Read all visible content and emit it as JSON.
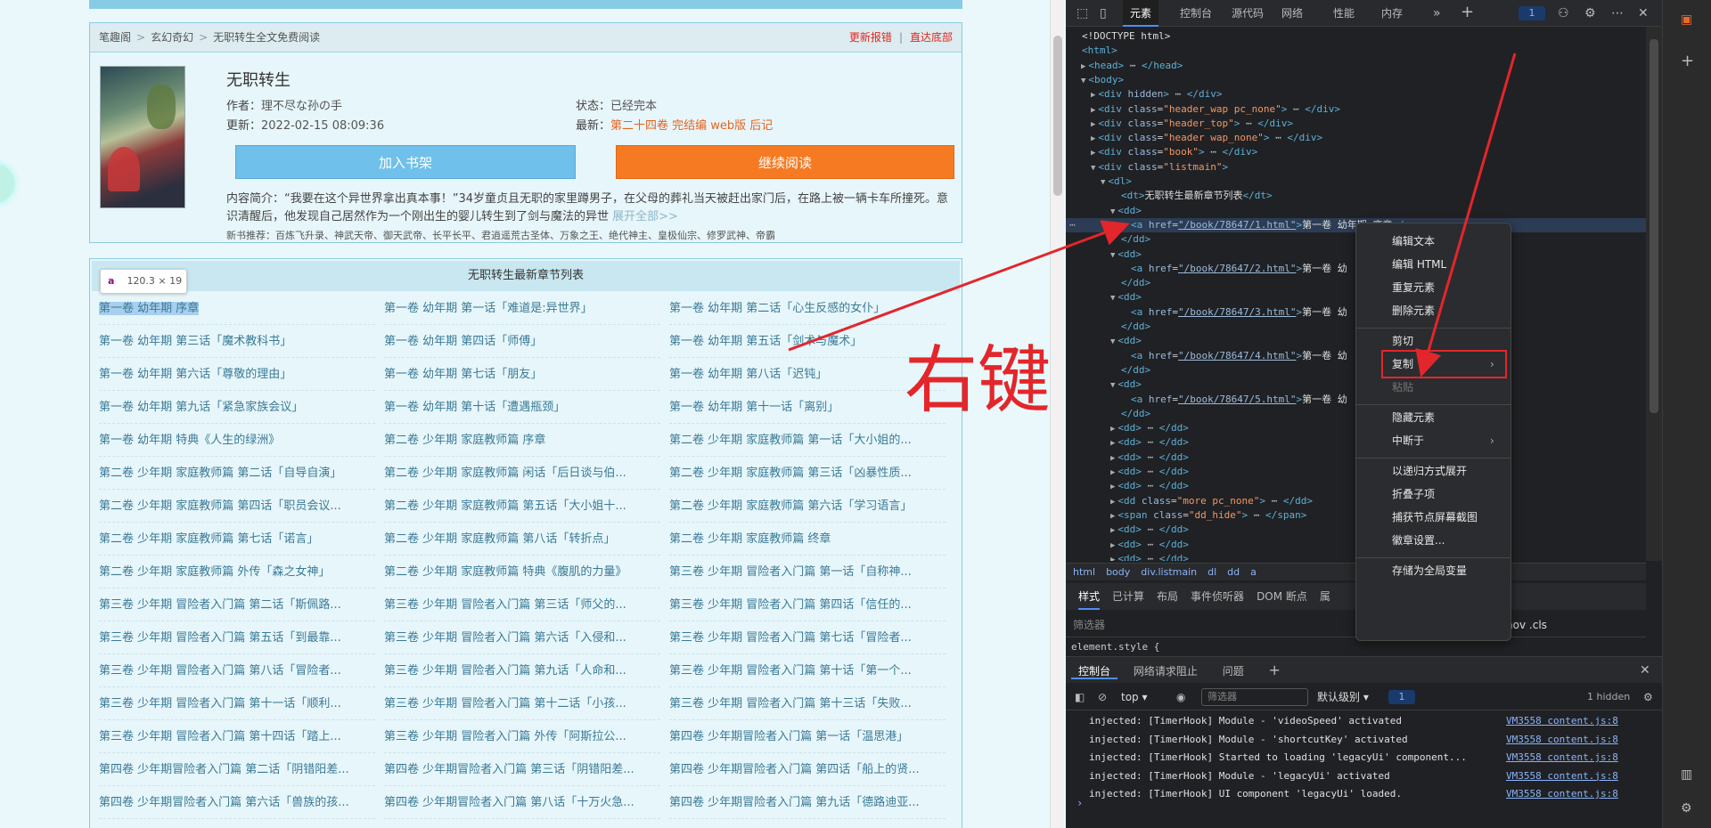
{
  "breadcrumb": {
    "items": [
      "笔趣阁",
      "玄幻奇幻",
      "无职转生全文免费阅读"
    ],
    "sep": ">",
    "right_links": [
      "更新报错",
      "直达底部"
    ]
  },
  "book": {
    "title": "无职转生",
    "author_label": "作者：",
    "author": "理不尽な孙の手",
    "status_label": "状态：",
    "status": "已经完本",
    "update_label": "更新：",
    "update": "2022-02-15 08:09:36",
    "latest_label": "最新：",
    "latest": "第二十四卷 完结编 web版 后记",
    "shelf_button": "加入书架",
    "read_button": "继续阅读",
    "intro": "内容简介：“我要在这个异世界拿出真本事！”34岁童贞且无职的家里蹲男子，在父母的葬礼当天被赶出家门后，在路上被一辆卡车所撞死。意识清醒后，他发现自己居然作为一个刚出生的婴儿转生到了剑与魔法的异世",
    "intro_more": "展开全部>>",
    "recommend": "新书推荐：百炼飞升录、神武天帝、御天武帝、长平长平、君逍遥荒古圣体、万象之王、绝代神主、皇极仙宗、修罗武神、帝霸"
  },
  "chapter_list": {
    "title": "无职转生最新章节列表",
    "chapters": [
      "第一卷 幼年期 序章",
      "第一卷 幼年期 第一话「难道是:异世界」",
      "第一卷 幼年期 第二话「心生反感的女仆」",
      "第一卷 幼年期 第三话「魔术教科书」",
      "第一卷 幼年期 第四话「师傅」",
      "第一卷 幼年期 第五话「剑术与魔术」",
      "第一卷 幼年期 第六话「尊敬的理由」",
      "第一卷 幼年期 第七话「朋友」",
      "第一卷 幼年期 第八话「迟钝」",
      "第一卷 幼年期 第九话「紧急家族会议」",
      "第一卷 幼年期 第十话「遭遇瓶颈」",
      "第一卷 幼年期 第十一话「离别」",
      "第一卷 幼年期 特典《人生的绿洲》",
      "第二卷 少年期 家庭教师篇 序章",
      "第二卷 少年期 家庭教师篇 第一话「大小姐的...",
      "第二卷 少年期 家庭教师篇 第二话「自导自演」",
      "第二卷 少年期 家庭教师篇 闲话「后日谈与伯...",
      "第二卷 少年期 家庭教师篇 第三话「凶暴性质...",
      "第二卷 少年期 家庭教师篇 第四话「职员会议...",
      "第二卷 少年期 家庭教师篇 第五话「大小姐十...",
      "第二卷 少年期 家庭教师篇 第六话「学习语言」",
      "第二卷 少年期 家庭教师篇 第七话「诺言」",
      "第二卷 少年期 家庭教师篇 第八话「转折点」",
      "第二卷 少年期 家庭教师篇 终章",
      "第二卷 少年期 家庭教师篇 外传「森之女神」",
      "第二卷 少年期 家庭教师篇 特典《腹肌的力量》",
      "第三卷 少年期 冒险者入门篇 第一话「自称神...",
      "第三卷 少年期 冒险者入门篇 第二话「斯佩路...",
      "第三卷 少年期 冒险者入门篇 第三话「师父的...",
      "第三卷 少年期 冒险者入门篇 第四话「信任的...",
      "第三卷 少年期 冒险者入门篇 第五话「到最靠...",
      "第三卷 少年期 冒险者入门篇 第六话「入侵和...",
      "第三卷 少年期 冒险者入门篇 第七话「冒险者...",
      "第三卷 少年期 冒险者入门篇 第八话「冒险者...",
      "第三卷 少年期 冒险者入门篇 第九话「人命和...",
      "第三卷 少年期 冒险者入门篇 第十话「第一个...",
      "第三卷 少年期 冒险者入门篇 第十一话「顺利...",
      "第三卷 少年期 冒险者入门篇 第十二话「小孩...",
      "第三卷 少年期 冒险者入门篇 第十三话「失败...",
      "第三卷 少年期 冒险者入门篇 第十四话「踏上...",
      "第三卷 少年期 冒险者入门篇 外传「阿斯拉公...",
      "第四卷 少年期冒险者入门篇 第一话「温思港」",
      "第四卷 少年期冒险者入门篇 第二话「阴错阳差...",
      "第四卷 少年期冒险者入门篇 第三话「阴错阳差...",
      "第四卷 少年期冒险者入门篇 第四话「船上的贤...",
      "第四卷 少年期冒险者入门篇 第六话「兽族的孩...",
      "第四卷 少年期冒险者入门篇 第八话「十万火急...",
      "第四卷 少年期冒险者入门篇 第九话「德路迪亚..."
    ]
  },
  "tooltip": {
    "tag": "a",
    "size": "120.3 × 19"
  },
  "annotation": {
    "text": "右键",
    "color": "#e3262b"
  },
  "devtools": {
    "tabs": [
      "元素",
      "控制台",
      "源代码",
      "网络",
      "性能",
      "内存"
    ],
    "issues_badge": "1",
    "dom_lines": [
      {
        "indent": 0,
        "html": "&lt;!DOCTYPE html&gt;",
        "kind": "txt"
      },
      {
        "indent": 0,
        "html": "<span class=tag>&lt;html&gt;</span>"
      },
      {
        "indent": 1,
        "html": "<span class=tag>&lt;head&gt;</span> ⋯ <span class=tag>&lt;/head&gt;</span>",
        "arrow": "▶"
      },
      {
        "indent": 1,
        "html": "<span class=tag>&lt;body&gt;</span>",
        "arrow": "▼"
      },
      {
        "indent": 2,
        "html": "<span class=tag>&lt;div</span> <span class=attr>hidden</span><span class=tag>&gt;</span> ⋯ <span class=tag>&lt;/div&gt;</span>",
        "arrow": "▶"
      },
      {
        "indent": 2,
        "html": "<span class=tag>&lt;div</span> <span class=attr>class</span>=<span class=val>\"header_wap pc_none\"</span><span class=tag>&gt;</span> ⋯ <span class=tag>&lt;/div&gt;</span>",
        "arrow": "▶"
      },
      {
        "indent": 2,
        "html": "<span class=tag>&lt;div</span> <span class=attr>class</span>=<span class=val>\"header_top\"</span><span class=tag>&gt;</span> ⋯ <span class=tag>&lt;/div&gt;</span>",
        "arrow": "▶"
      },
      {
        "indent": 2,
        "html": "<span class=tag>&lt;div</span> <span class=attr>class</span>=<span class=val>\"header wap_none\"</span><span class=tag>&gt;</span> ⋯ <span class=tag>&lt;/div&gt;</span>",
        "arrow": "▶"
      },
      {
        "indent": 2,
        "html": "<span class=tag>&lt;div</span> <span class=attr>class</span>=<span class=val>\"book\"</span><span class=tag>&gt;</span> ⋯ <span class=tag>&lt;/div&gt;</span>",
        "arrow": "▶"
      },
      {
        "indent": 2,
        "html": "<span class=tag>&lt;div</span> <span class=attr>class</span>=<span class=val>\"listmain\"</span><span class=tag>&gt;</span>",
        "arrow": "▼"
      },
      {
        "indent": 3,
        "html": "<span class=tag>&lt;dl&gt;</span>",
        "arrow": "▼"
      },
      {
        "indent": 4,
        "html": "<span class=tag>&lt;dt&gt;</span><span class=txt>无职转生最新章节列表</span><span class=tag>&lt;/dt&gt;</span>"
      },
      {
        "indent": 4,
        "html": "<span class=tag>&lt;dd&gt;</span>",
        "arrow": "▼"
      },
      {
        "indent": 5,
        "html": "<span class=tag>&lt;a</span> <span class=attr>href</span>=<span class=link>\"/book/78647/1.html\"</span><span class=tag>&gt;</span><span class=txt>第一卷 幼年期 序章</span><span class=tag>&lt;/a&gt;</span>",
        "hl": true
      },
      {
        "indent": 4,
        "html": "<span class=tag>&lt;/dd&gt;</span>"
      },
      {
        "indent": 4,
        "html": "<span class=tag>&lt;dd&gt;</span>",
        "arrow": "▼"
      },
      {
        "indent": 5,
        "html": "<span class=tag>&lt;a</span> <span class=attr>href</span>=<span class=link>\"/book/78647/2.html\"</span><span class=tag>&gt;</span><span class=txt>第一卷 幼</span>"
      },
      {
        "indent": 4,
        "html": "<span class=tag>&lt;/dd&gt;</span>"
      },
      {
        "indent": 4,
        "html": "<span class=tag>&lt;dd&gt;</span>",
        "arrow": "▼"
      },
      {
        "indent": 5,
        "html": "<span class=tag>&lt;a</span> <span class=attr>href</span>=<span class=link>\"/book/78647/3.html\"</span><span class=tag>&gt;</span><span class=txt>第一卷 幼</span>"
      },
      {
        "indent": 4,
        "html": "<span class=tag>&lt;/dd&gt;</span>"
      },
      {
        "indent": 4,
        "html": "<span class=tag>&lt;dd&gt;</span>",
        "arrow": "▼"
      },
      {
        "indent": 5,
        "html": "<span class=tag>&lt;a</span> <span class=attr>href</span>=<span class=link>\"/book/78647/4.html\"</span><span class=tag>&gt;</span><span class=txt>第一卷 幼</span>"
      },
      {
        "indent": 4,
        "html": "<span class=tag>&lt;/dd&gt;</span>"
      },
      {
        "indent": 4,
        "html": "<span class=tag>&lt;dd&gt;</span>",
        "arrow": "▼"
      },
      {
        "indent": 5,
        "html": "<span class=tag>&lt;a</span> <span class=attr>href</span>=<span class=link>\"/book/78647/5.html\"</span><span class=tag>&gt;</span><span class=txt>第一卷 幼</span>"
      },
      {
        "indent": 4,
        "html": "<span class=tag>&lt;/dd&gt;</span>"
      },
      {
        "indent": 4,
        "html": "<span class=tag>&lt;dd&gt;</span> ⋯ <span class=tag>&lt;/dd&gt;</span>",
        "arrow": "▶"
      },
      {
        "indent": 4,
        "html": "<span class=tag>&lt;dd&gt;</span> ⋯ <span class=tag>&lt;/dd&gt;</span>",
        "arrow": "▶"
      },
      {
        "indent": 4,
        "html": "<span class=tag>&lt;dd&gt;</span> ⋯ <span class=tag>&lt;/dd&gt;</span>",
        "arrow": "▶"
      },
      {
        "indent": 4,
        "html": "<span class=tag>&lt;dd&gt;</span> ⋯ <span class=tag>&lt;/dd&gt;</span>",
        "arrow": "▶"
      },
      {
        "indent": 4,
        "html": "<span class=tag>&lt;dd&gt;</span> ⋯ <span class=tag>&lt;/dd&gt;</span>",
        "arrow": "▶"
      },
      {
        "indent": 4,
        "html": "<span class=tag>&lt;dd</span> <span class=attr>class</span>=<span class=val>\"more pc_none\"</span><span class=tag>&gt;</span> ⋯ <span class=tag>&lt;/dd&gt;</span>",
        "arrow": "▶"
      },
      {
        "indent": 4,
        "html": "<span class=tag>&lt;span</span> <span class=attr>class</span>=<span class=val>\"dd_hide\"</span><span class=tag>&gt;</span> ⋯ <span class=tag>&lt;/span&gt;</span>",
        "arrow": "▶"
      },
      {
        "indent": 4,
        "html": "<span class=tag>&lt;dd&gt;</span> ⋯ <span class=tag>&lt;/dd&gt;</span>",
        "arrow": "▶"
      },
      {
        "indent": 4,
        "html": "<span class=tag>&lt;dd&gt;</span> ⋯ <span class=tag>&lt;/dd&gt;</span>",
        "arrow": "▶"
      },
      {
        "indent": 4,
        "html": "<span class=tag>&lt;dd&gt;</span> ⋯ <span class=tag>&lt;/dd&gt;</span>",
        "arrow": "▶"
      }
    ],
    "breadcrumb": [
      "html",
      "body",
      "div.listmain",
      "dl",
      "dd",
      "a"
    ],
    "style_tabs": [
      "样式",
      "已计算",
      "布局",
      "事件侦听器",
      "DOM 断点",
      "属"
    ],
    "filter_placeholder": "筛选器",
    "filter_right": ":hov .cls",
    "element_style": "element.style {",
    "console_tabs": [
      "控制台",
      "网络请求阻止",
      "问题"
    ],
    "console_top": "top",
    "console_filter": "筛选器",
    "console_level": "默认级别",
    "console_badge": "1",
    "console_hidden": "1 hidden",
    "console_lines": [
      {
        "text": "injected: [TimerHook] Module - 'videoSpeed' activated",
        "src": "VM3558 content.js:8"
      },
      {
        "text": "injected: [TimerHook] Module - 'shortcutKey' activated",
        "src": "VM3558 content.js:8"
      },
      {
        "text": "injected: [TimerHook] Started to loading 'legacyUi' component...",
        "src": "VM3558 content.js:8"
      },
      {
        "text": "injected: [TimerHook] Module - 'legacyUi' activated",
        "src": "VM3558 content.js:8"
      },
      {
        "text": "injected: [TimerHook] UI component 'legacyUi' loaded.",
        "src": "VM3558 content.js:8"
      }
    ]
  },
  "context_menu": {
    "groups": [
      [
        "编辑文本",
        "编辑 HTML",
        "重复元素",
        "删除元素"
      ],
      [
        "剪切",
        "复制",
        "粘贴"
      ],
      [
        "隐藏元素",
        "中断于"
      ],
      [
        "以递归方式展开",
        "折叠子项",
        "捕获节点屏幕截图",
        "徽章设置..."
      ],
      [
        "存储为全局变量"
      ]
    ],
    "disabled": [
      "粘贴"
    ],
    "submenu": [
      "复制",
      "中断于"
    ],
    "highlighted": "复制"
  }
}
